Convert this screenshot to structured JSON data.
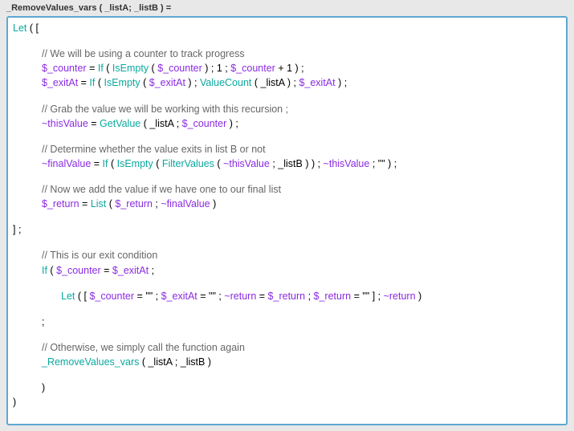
{
  "header": {
    "title": "_RemoveValues_vars ( _listA; _listB ) ="
  },
  "code": {
    "let_open": "Let",
    "bracket_open_arr": " ( [",
    "comment1": "// We will be using a counter to track progress",
    "line_counter_var": "$_counter",
    "line_counter_eq": " = ",
    "fn_if": "If",
    "fn_isempty": "IsEmpty",
    "num_one": "1",
    "plus_one": " + 1",
    "line_exitat_var": "$_exitAt",
    "fn_valuecount": "ValueCount",
    "param_lista": "_listA",
    "comment2": "// Grab the value we will be working with this recursion ;",
    "var_thisvalue": "~thisValue",
    "fn_getvalue": "GetValue",
    "comment3": "// Determine whether the value exits in list B or not",
    "var_finalvalue": "~finalValue",
    "fn_filtervalues": "FilterValues",
    "param_listb": "_listB",
    "empty_str": "\"\"",
    "comment4": "// Now we add the value if we have one to our final list",
    "var_return": "$_return",
    "fn_list": "List",
    "bracket_close_arr": "] ;",
    "comment5": "// This is our exit condition",
    "var_tilde_return": "~return",
    "semicolon": ";",
    "comment6": "// Otherwise, we simply call the function again",
    "fn_recurse": "_RemoveValues_vars",
    "close_paren": ")"
  }
}
